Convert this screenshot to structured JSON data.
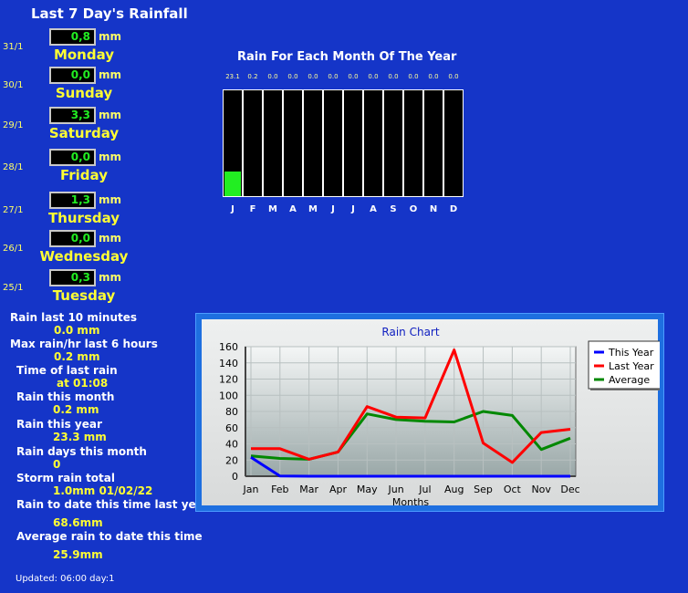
{
  "title": "Last 7 Day's Rainfall",
  "unit": "mm",
  "days": [
    {
      "date": "31/1",
      "value": "0,8",
      "name": "Monday"
    },
    {
      "date": "30/1",
      "value": "0,0",
      "name": "Sunday"
    },
    {
      "date": "29/1",
      "value": "3,3",
      "name": "Saturday"
    },
    {
      "date": "28/1",
      "value": "0,0",
      "name": "Friday"
    },
    {
      "date": "27/1",
      "value": "1,3",
      "name": "Thursday"
    },
    {
      "date": "26/1",
      "value": "0,0",
      "name": "Wednesday"
    },
    {
      "date": "25/1",
      "value": "0,3",
      "name": "Tuesday"
    }
  ],
  "stats": [
    {
      "label": "Rain last 10 minutes",
      "value": "0.0 mm"
    },
    {
      "label": "Max rain/hr last 6 hours",
      "value": "0.2 mm"
    },
    {
      "label": "Time of last rain",
      "value": "at 01:08"
    },
    {
      "label": "Rain this month",
      "value": "0.2 mm"
    },
    {
      "label": "Rain this year",
      "value": "23.3 mm"
    },
    {
      "label": "Rain days this month",
      "value": "0"
    },
    {
      "label": "Storm rain total",
      "value": "1.0mm 01/02/22"
    },
    {
      "label": "Rain to date this time last year",
      "value": "68.6mm"
    },
    {
      "label": "Average rain to date this time",
      "value": "25.9mm"
    }
  ],
  "updated": "Updated: 06:00 day:1",
  "colors": {
    "background": "#1535c8",
    "label_yellow": "#ffff33",
    "value_green": "#22ee22"
  },
  "chart_data": [
    {
      "type": "bar",
      "title": "Rain For Each Month Of The Year",
      "categories": [
        "J",
        "F",
        "M",
        "A",
        "M",
        "J",
        "J",
        "A",
        "S",
        "O",
        "N",
        "D"
      ],
      "values": [
        23.1,
        0.2,
        0.0,
        0.0,
        0.0,
        0.0,
        0.0,
        0.0,
        0.0,
        0.0,
        0.0,
        0.0
      ],
      "value_labels": [
        "23.1",
        "0.2",
        "0.0",
        "0.0",
        "0.0",
        "0.0",
        "0.0",
        "0.0",
        "0.0",
        "0.0",
        "0.0",
        "0.0"
      ],
      "ylim": [
        0,
        100
      ]
    },
    {
      "type": "line",
      "title": "Rain Chart",
      "xlabel": "Months",
      "ylabel": "",
      "ylim": [
        0,
        160
      ],
      "yticks": [
        0,
        20,
        40,
        60,
        80,
        100,
        120,
        140,
        160
      ],
      "categories": [
        "Jan",
        "Feb",
        "Mar",
        "Apr",
        "May",
        "Jun",
        "Jul",
        "Aug",
        "Sep",
        "Oct",
        "Nov",
        "Dec"
      ],
      "grid": true,
      "legend": "top-right",
      "series": [
        {
          "name": "This Year",
          "color": "#0000ff",
          "values": [
            23.3,
            0.2,
            0,
            0,
            0,
            0,
            0,
            0,
            0,
            0,
            0,
            0
          ]
        },
        {
          "name": "Last Year",
          "color": "#ff0000",
          "values": [
            34,
            34,
            21,
            30,
            86,
            73,
            72,
            156,
            41,
            17,
            54,
            58
          ]
        },
        {
          "name": "Average",
          "color": "#008800",
          "values": [
            25,
            22,
            21,
            30,
            77,
            70,
            68,
            67,
            80,
            75,
            33,
            47
          ]
        }
      ]
    }
  ]
}
